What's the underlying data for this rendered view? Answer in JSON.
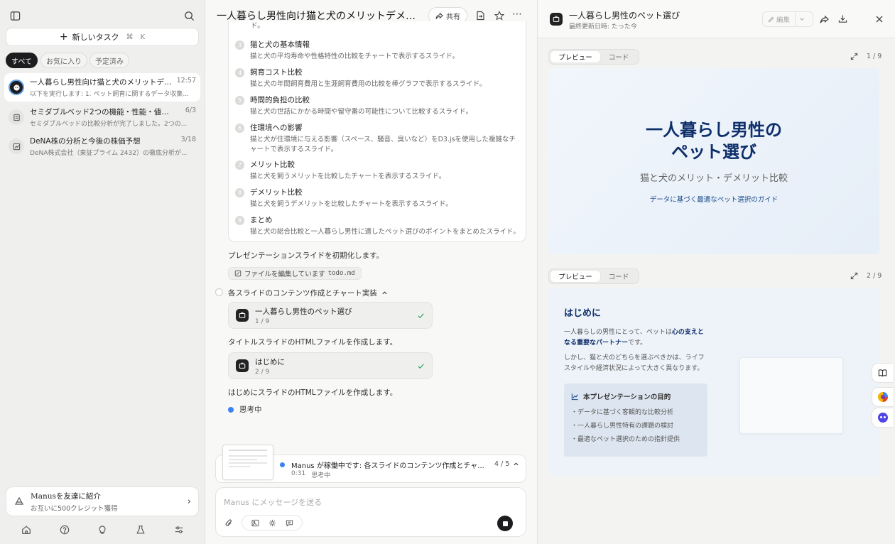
{
  "sidebar": {
    "new_task_label": "新しいタスク",
    "new_task_shortcut_cmd": "⌘",
    "new_task_shortcut_key": "K",
    "filters": [
      "すべて",
      "お気に入り",
      "予定済み"
    ],
    "tasks": [
      {
        "title": "一人暮らし男性向け猫と犬のメリットデメリ...",
        "date": "12:57",
        "subtitle": "以下を実行します: 1. ペット飼育に関するデータ収集..."
      },
      {
        "title": "セミダブルベッド2つの機能・性能・値段比較",
        "date": "6/3",
        "subtitle": "セミダブルベッドの比較分析が完了しました。2つの..."
      },
      {
        "title": "DeNA株の分析と今後の株価予想",
        "date": "3/18",
        "subtitle": "DeNA株式会社（東証プライム 2432）の徹底分析が..."
      }
    ],
    "promo_title": "Manusを友達に紹介",
    "promo_subtitle": "お互いに500クレジット獲得"
  },
  "chat": {
    "title": "一人暮らし男性向け猫と犬のメリットデメリッ...",
    "share_label": "共有",
    "plan_top_fragment": "ド。",
    "plan_steps": [
      {
        "num": "3",
        "title": "猫と犬の基本情報",
        "desc": "猫と犬の平均寿命や性格特性の比較をチャートで表示するスライド。"
      },
      {
        "num": "4",
        "title": "飼育コスト比較",
        "desc": "猫と犬の年間飼育費用と生涯飼育費用の比較を棒グラフで表示するスライド。"
      },
      {
        "num": "5",
        "title": "時間的負担の比較",
        "desc": "猫と犬の世話にかかる時間や留守番の可能性について比較するスライド。"
      },
      {
        "num": "6",
        "title": "住環境への影響",
        "desc": "猫と犬が住環境に与える影響（スペース、騒音、臭いなど）をD3.jsを使用した複雑なチャートで表示するスライド。"
      },
      {
        "num": "7",
        "title": "メリット比較",
        "desc": "猫と犬を飼うメリットを比較したチャートを表示するスライド。"
      },
      {
        "num": "8",
        "title": "デメリット比較",
        "desc": "猫と犬を飼うデメリットを比較したチャートを表示するスライド。"
      },
      {
        "num": "9",
        "title": "まとめ",
        "desc": "猫と犬の総合比較と一人暮らし男性に適したペット選びのポイントをまとめたスライド。"
      }
    ],
    "msg_init": "プレゼンテーションスライドを初期化します。",
    "editing_label": "ファイルを編集しています",
    "editing_file": "todo.md",
    "phase_label": "各スライドのコンテンツ作成とチャート実装",
    "card1_title": "一人暮らし男性のペット選び",
    "card1_sub": "1 / 9",
    "msg_card1": "タイトルスライドのHTMLファイルを作成します。",
    "card2_title": "はじめに",
    "card2_sub": "2 / 9",
    "msg_card2": "はじめにスライドのHTMLファイルを作成します。",
    "thinking_label": "思考中",
    "status_text": "Manus が稼働中です: 各スライドのコンテンツ作成とチャ...",
    "status_progress": "4 / 5",
    "status_time": "0:31",
    "status_sub": "思考中",
    "input_placeholder": "Manus にメッセージを送る"
  },
  "preview": {
    "title": "一人暮らし男性のペット選び",
    "updated": "最終更新日時: たった今",
    "edit_label": "編集",
    "tab_preview": "プレビュー",
    "tab_code": "コード",
    "slide1_counter": "1 / 9",
    "slide2_counter": "2 / 9",
    "slide1_title_line1": "一人暮らし男性の",
    "slide1_title_line2": "ペット選び",
    "slide1_subtitle": "猫と犬のメリット・デメリット比較",
    "slide1_caption": "データに基づく最適なペット選択のガイド",
    "slide2_heading": "はじめに",
    "slide2_p1_pre": "一人暮らしの男性にとって、ペットは",
    "slide2_p1_bold": "心の支えとなる重要なパートナー",
    "slide2_p1_post": "です。",
    "slide2_p2": "しかし、猫と犬のどちらを選ぶべきかは、ライフスタイルや経済状況によって大きく異なります。",
    "purpose_title": "本プレゼンテーションの目的",
    "purpose_items": [
      "・データに基づく客観的な比較分析",
      "・一人暮らし男性特有の課題の検討",
      "・最適なペット選択のための指針提供"
    ]
  },
  "colors": {
    "accent_navy": "#0f2f6b",
    "thinking_dot": "#3b82f6",
    "check_green": "#3aa66b"
  }
}
